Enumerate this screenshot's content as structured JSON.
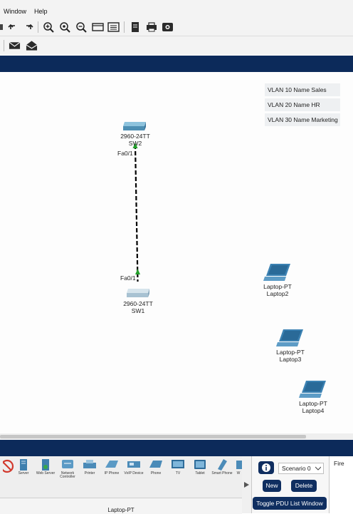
{
  "menu": {
    "window": "Window",
    "help": "Help"
  },
  "toolbar": {
    "icons": [
      "undo-icon",
      "redo-icon",
      "zoom-in-icon",
      "zoom-custom-icon",
      "zoom-out-icon",
      "window-icon",
      "list-icon",
      "document-icon",
      "print-icon",
      "image-icon"
    ],
    "secondary_icons": [
      "envelope-icon",
      "open-envelope-icon"
    ]
  },
  "workspace": {
    "notes": [
      "VLAN 10 Name Sales",
      "VLAN 20 Name HR",
      "VLAN 30 Name Marketing"
    ],
    "devices": {
      "sw2": {
        "model": "2960-24TT",
        "name": "SW2",
        "port": "Fa0/1"
      },
      "sw1": {
        "model": "2960-24TT",
        "name": "SW1",
        "port": "Fa0/1"
      },
      "laptop2": {
        "model": "Laptop-PT",
        "name": "Laptop2"
      },
      "laptop3": {
        "model": "Laptop-PT",
        "name": "Laptop3"
      },
      "laptop4": {
        "model": "Laptop-PT",
        "name": "Laptop4"
      }
    }
  },
  "device_bar": {
    "items": [
      {
        "label": "",
        "icon": "no-entry-icon"
      },
      {
        "label": "Server",
        "icon": "server-icon"
      },
      {
        "label": "Web Server",
        "icon": "web-server-icon"
      },
      {
        "label": "Network Controller",
        "icon": "network-controller-icon"
      },
      {
        "label": "Printer",
        "icon": "printer-icon"
      },
      {
        "label": "IP Phone",
        "icon": "ip-phone-icon"
      },
      {
        "label": "VoIP Device",
        "icon": "voip-device-icon"
      },
      {
        "label": "Phone",
        "icon": "phone-icon"
      },
      {
        "label": "TV",
        "icon": "tv-icon"
      },
      {
        "label": "Tablet",
        "icon": "tablet-icon"
      },
      {
        "label": "Smart Phone",
        "icon": "smart-phone-icon"
      },
      {
        "label": "W",
        "icon": "wireless-icon"
      }
    ],
    "selected_label": "Laptop-PT"
  },
  "scenario": {
    "selected": "Scenario 0",
    "new_label": "New",
    "delete_label": "Delete",
    "toggle_label": "Toggle PDU List Window",
    "fire_label": "Fire"
  },
  "colors": {
    "band": "#0c2a5a",
    "switch": "#5f9fc2",
    "laptop": "#3c82b3",
    "link": "#000000",
    "port_up": "#23a02a"
  }
}
